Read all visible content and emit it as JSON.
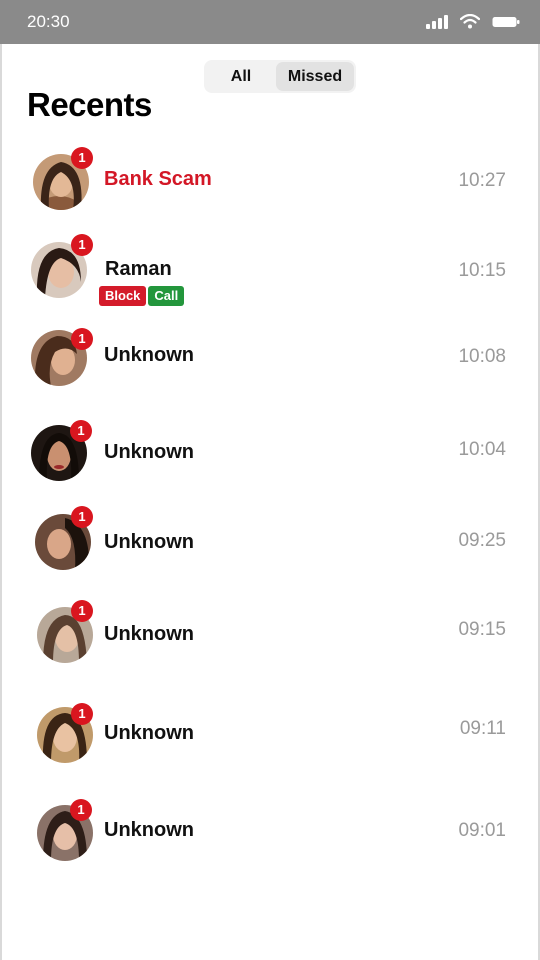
{
  "status_bar": {
    "time": "20:30"
  },
  "filter": {
    "all_label": "All",
    "missed_label": "Missed",
    "selected": "Missed"
  },
  "page_title": "Recents",
  "calls": [
    {
      "name": "Bank Scam",
      "time": "10:27",
      "missed_count": "1",
      "flag": "scam"
    },
    {
      "name": "Raman",
      "time": "10:15",
      "missed_count": "1",
      "block_label": "Block",
      "call_label": "Call"
    },
    {
      "name": "Unknown",
      "time": "10:08",
      "missed_count": "1"
    },
    {
      "name": "Unknown",
      "time": "10:04",
      "missed_count": "1"
    },
    {
      "name": "Unknown",
      "time": "09:25",
      "missed_count": "1"
    },
    {
      "name": "Unknown",
      "time": "09:15",
      "missed_count": "1"
    },
    {
      "name": "Unknown",
      "time": "09:11",
      "missed_count": "1"
    },
    {
      "name": "Unknown",
      "time": "09:01",
      "missed_count": "1"
    }
  ],
  "colors": {
    "status_bar": "#8a8a8a",
    "badge": "#d9161f",
    "scam_name": "#d31726",
    "block_button": "#d41b2a",
    "call_button": "#23963c",
    "time_text": "#9a9a9a"
  }
}
